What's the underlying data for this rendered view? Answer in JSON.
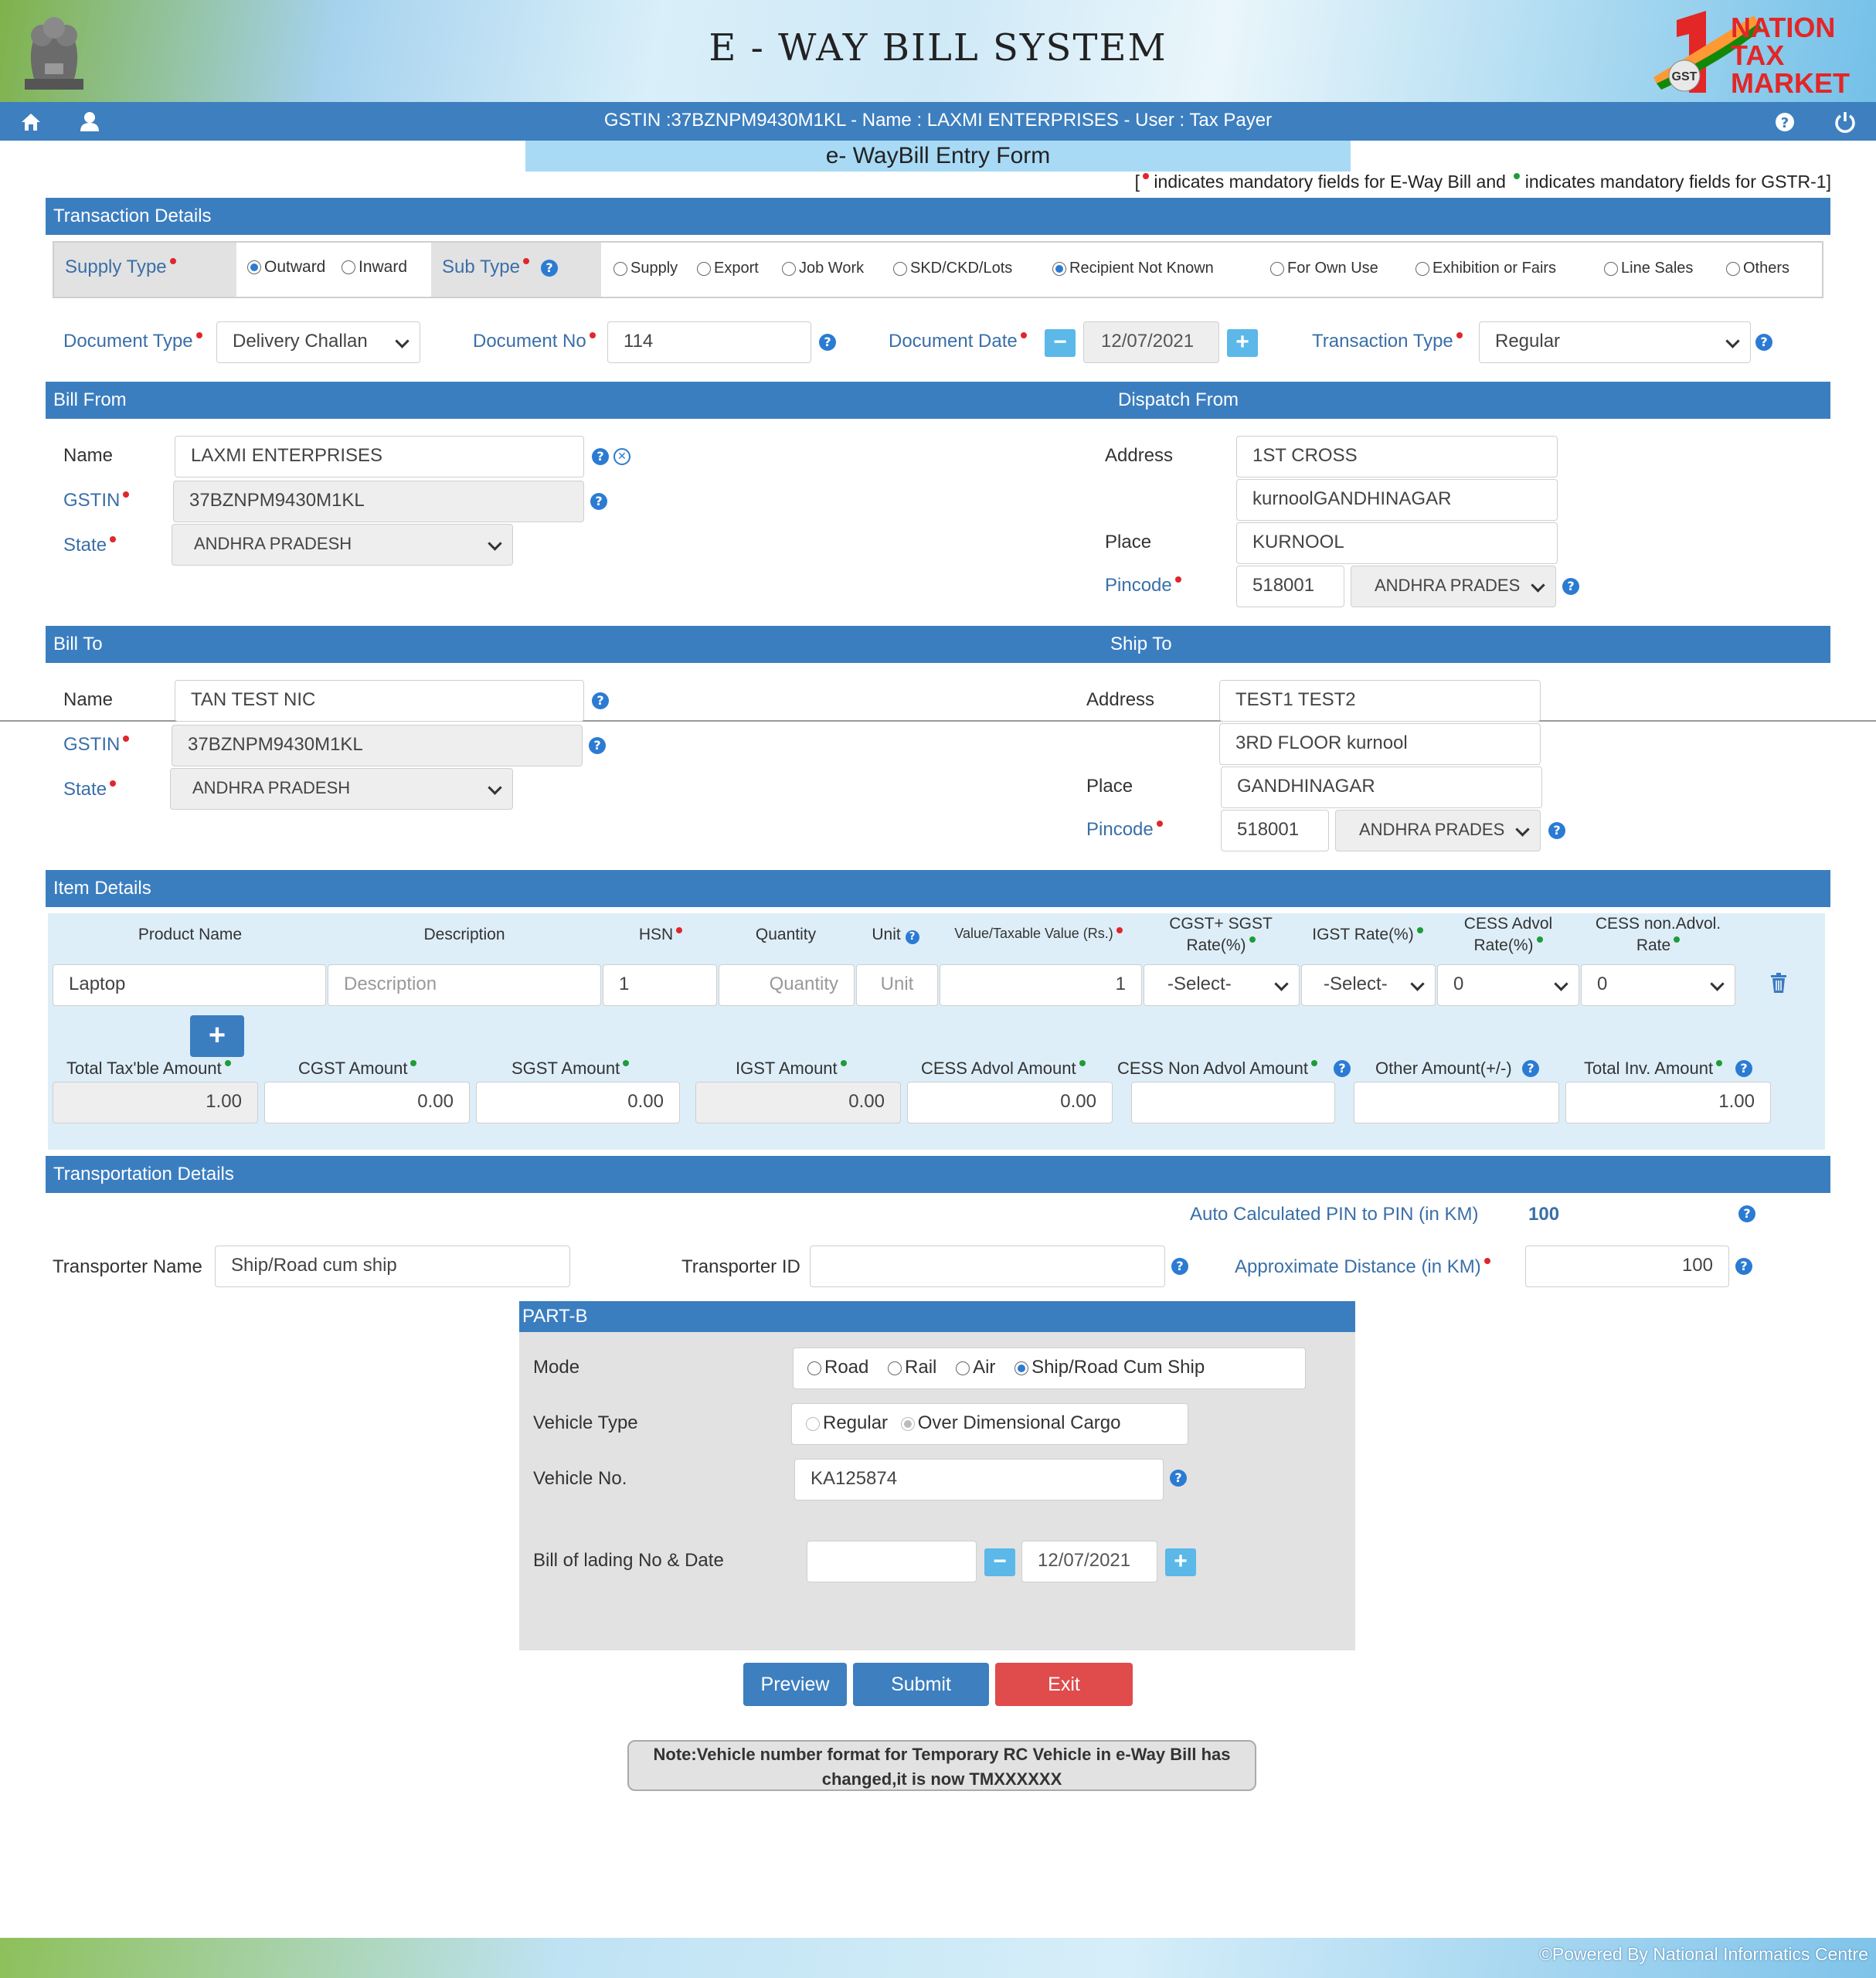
{
  "header": {
    "title": "E - WAY BILL SYSTEM",
    "logo_lines": [
      "NATION",
      "TAX",
      "MARKET"
    ],
    "logo_badge": "GST",
    "user_info": "GSTIN :37BZNPM9430M1KL - Name : LAXMI ENTERPRISES - User : Tax Payer"
  },
  "form_title": "e- WayBill Entry Form",
  "mandatory_note": {
    "open": "[",
    "part1": " indicates mandatory fields for E-Way Bill and ",
    "part2": " indicates mandatory fields for GSTR-1]"
  },
  "transaction": {
    "section": "Transaction Details",
    "supply_type_label": "Supply Type",
    "supply_options": [
      {
        "label": "Outward",
        "selected": true
      },
      {
        "label": "Inward",
        "selected": false
      }
    ],
    "sub_type_label": "Sub Type",
    "sub_options": [
      {
        "label": "Supply",
        "selected": false
      },
      {
        "label": "Export",
        "selected": false
      },
      {
        "label": "Job Work",
        "selected": false
      },
      {
        "label": "SKD/CKD/Lots",
        "selected": false
      },
      {
        "label": "Recipient Not Known",
        "selected": true
      },
      {
        "label": "For Own Use",
        "selected": false
      },
      {
        "label": "Exhibition or Fairs",
        "selected": false
      },
      {
        "label": "Line Sales",
        "selected": false
      },
      {
        "label": "Others",
        "selected": false
      }
    ],
    "document_type_label": "Document Type",
    "document_type_value": "Delivery Challan",
    "document_no_label": "Document No",
    "document_no_value": "114",
    "document_date_label": "Document Date",
    "document_date_value": "12/07/2021",
    "transaction_type_label": "Transaction Type",
    "transaction_type_value": "Regular"
  },
  "bill_from": {
    "section": "Bill From",
    "name_label": "Name",
    "name_value": "LAXMI ENTERPRISES",
    "gstin_label": "GSTIN",
    "gstin_value": "37BZNPM9430M1KL",
    "state_label": "State",
    "state_value": "ANDHRA PRADESH"
  },
  "dispatch_from": {
    "section": "Dispatch From",
    "address_label": "Address",
    "address1": "1ST CROSS",
    "address2": "kurnoolGANDHINAGAR",
    "place_label": "Place",
    "place_value": "KURNOOL",
    "pincode_label": "Pincode",
    "pincode_value": "518001",
    "state_value": "ANDHRA PRADES"
  },
  "bill_to": {
    "section": "Bill To",
    "name_label": "Name",
    "name_value": "TAN TEST NIC",
    "gstin_label": "GSTIN",
    "gstin_value": "37BZNPM9430M1KL",
    "state_label": "State",
    "state_value": "ANDHRA PRADESH"
  },
  "ship_to": {
    "section": "Ship To",
    "address_label": "Address",
    "address1": "TEST1 TEST2",
    "address2": "3RD FLOOR kurnool",
    "place_label": "Place",
    "place_value": "GANDHINAGAR",
    "pincode_label": "Pincode",
    "pincode_value": "518001",
    "state_value": "ANDHRA PRADES"
  },
  "items": {
    "section": "Item Details",
    "headers": {
      "product": "Product Name",
      "description": "Description",
      "hsn": "HSN",
      "quantity": "Quantity",
      "unit": "Unit",
      "value": "Value/Taxable Value (Rs.)",
      "cgst_sgst_1": "CGST+ SGST",
      "cgst_sgst_2": "Rate(%)",
      "igst": "IGST Rate(%)",
      "cess_advol_1": "CESS Advol",
      "cess_advol_2": "Rate(%)",
      "cess_nonadvol_1": "CESS non.Advol.",
      "cess_nonadvol_2": "Rate"
    },
    "row": {
      "product": "Laptop",
      "description_placeholder": "Description",
      "hsn": "1",
      "quantity_placeholder": "Quantity",
      "unit_placeholder": "Unit",
      "value": "1",
      "cgst_sgst": "-Select-",
      "igst": "-Select-",
      "cess_advol": "0",
      "cess_nonadvol": "0"
    },
    "totals": {
      "taxable_label": "Total Tax'ble Amount",
      "taxable_value": "1.00",
      "cgst_label": "CGST Amount",
      "cgst_value": "0.00",
      "sgst_label": "SGST Amount",
      "sgst_value": "0.00",
      "igst_label": "IGST Amount",
      "igst_value": "0.00",
      "cess_advol_label": "CESS Advol Amount",
      "cess_advol_value": "0.00",
      "cess_nonadvol_label": "CESS Non Advol Amount",
      "cess_nonadvol_value": "",
      "other_label": "Other Amount(+/-)",
      "other_value": "",
      "total_inv_label": "Total Inv. Amount",
      "total_inv_value": "1.00"
    }
  },
  "transport": {
    "section": "Transportation Details",
    "auto_pin_label": "Auto Calculated PIN to PIN (in KM)",
    "auto_pin_value": "100",
    "transporter_name_label": "Transporter Name",
    "transporter_name_value": "Ship/Road cum ship",
    "transporter_id_label": "Transporter ID",
    "transporter_id_value": "",
    "approx_distance_label": "Approximate Distance (in KM)",
    "approx_distance_value": "100"
  },
  "part_b": {
    "section": "PART-B",
    "mode_label": "Mode",
    "modes": [
      {
        "label": "Road",
        "selected": false
      },
      {
        "label": "Rail",
        "selected": false
      },
      {
        "label": "Air",
        "selected": false
      },
      {
        "label": "Ship/Road Cum Ship",
        "selected": true
      }
    ],
    "vehicle_type_label": "Vehicle Type",
    "vehicle_types": [
      {
        "label": "Regular",
        "selected": false
      },
      {
        "label": "Over Dimensional Cargo",
        "selected": true
      }
    ],
    "vehicle_no_label": "Vehicle No.",
    "vehicle_no_value": "KA125874",
    "bill_lading_label": "Bill of lading No & Date",
    "bill_lading_no": "",
    "bill_lading_date": "12/07/2021"
  },
  "buttons": {
    "preview": "Preview",
    "submit": "Submit",
    "exit": "Exit"
  },
  "note": "Note:Vehicle number format for Temporary RC Vehicle in e-Way Bill has changed,it is now TMXXXXXX",
  "footer": "©Powered By National Informatics Centre",
  "colors": {
    "section_bar": "#3b7ec0",
    "label_blue": "#3a6fa8",
    "mandatory_red": "#e0262d",
    "mandatory_green": "#1f9b3a",
    "submit": "#3d7fbf",
    "exit": "#e04b4b"
  }
}
